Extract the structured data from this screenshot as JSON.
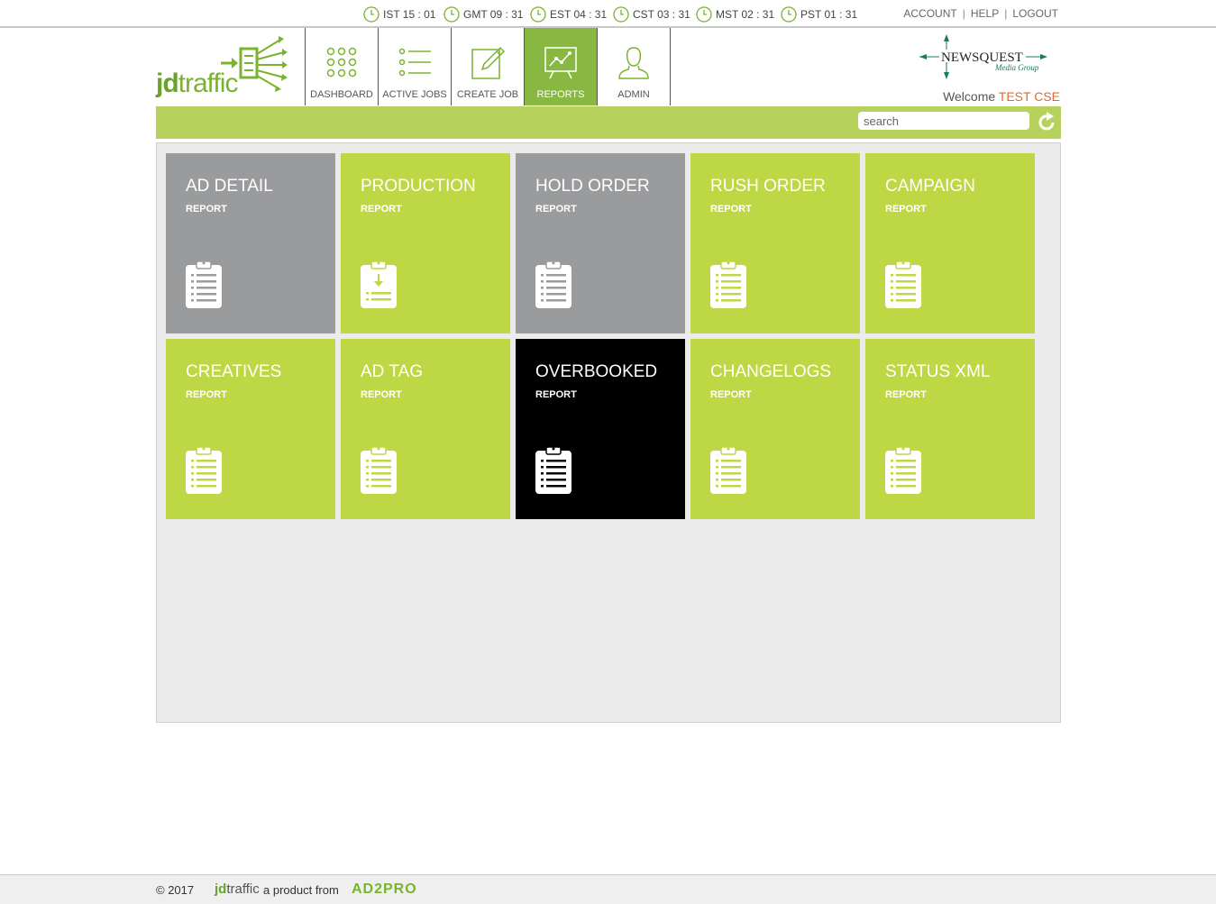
{
  "clocks": [
    {
      "label": "IST 15 : 01"
    },
    {
      "label": "GMT 09 : 31"
    },
    {
      "label": "EST 04 : 31"
    },
    {
      "label": "CST 03 : 31"
    },
    {
      "label": "MST 02 : 31"
    },
    {
      "label": "PST 01 : 31"
    }
  ],
  "toplinks": {
    "account": "ACCOUNT",
    "help": "HELP",
    "logout": "LOGOUT",
    "separator": "|"
  },
  "logo": {
    "jd": "jd",
    "traffic": "traffic"
  },
  "nav": [
    {
      "label": "DASHBOARD",
      "icon": "dots-grid-icon"
    },
    {
      "label": "ACTIVE JOBS",
      "icon": "list-icon"
    },
    {
      "label": "CREATE JOB",
      "icon": "edit-icon"
    },
    {
      "label": "REPORTS",
      "icon": "presentation-chart-icon",
      "active": true
    },
    {
      "label": "ADMIN",
      "icon": "user-icon"
    }
  ],
  "partner_logo": {
    "name": "NEWSQUEST",
    "sub": "Media Group"
  },
  "welcome": {
    "prefix": "Welcome",
    "user": "TEST CSE"
  },
  "search": {
    "placeholder": "search",
    "value": ""
  },
  "tiles": [
    {
      "title": "AD DETAIL",
      "subtitle": "REPORT",
      "color": "#9a9b9d",
      "icon": "clipboard-list-icon"
    },
    {
      "title": "PRODUCTION",
      "subtitle": "REPORT",
      "color": "#bed744",
      "icon": "clipboard-download-icon"
    },
    {
      "title": "HOLD ORDER",
      "subtitle": "REPORT",
      "color": "#9a9b9d",
      "icon": "clipboard-list-icon"
    },
    {
      "title": "RUSH ORDER",
      "subtitle": "REPORT",
      "color": "#bed744",
      "icon": "clipboard-list-icon"
    },
    {
      "title": "CAMPAIGN",
      "subtitle": "REPORT",
      "color": "#bed744",
      "icon": "clipboard-list-icon"
    },
    {
      "title": "CREATIVES",
      "subtitle": "REPORT",
      "color": "#bed744",
      "icon": "clipboard-list-icon"
    },
    {
      "title": "AD TAG",
      "subtitle": "REPORT",
      "color": "#bed744",
      "icon": "clipboard-list-icon"
    },
    {
      "title": "OVERBOOKED",
      "subtitle": "REPORT",
      "color": "#000000",
      "icon": "clipboard-list-icon"
    },
    {
      "title": "CHANGELOGS",
      "subtitle": "REPORT",
      "color": "#bed744",
      "icon": "clipboard-list-icon"
    },
    {
      "title": "STATUS XML",
      "subtitle": "REPORT",
      "color": "#bed744",
      "icon": "clipboard-list-icon"
    }
  ],
  "footer": {
    "copyright": "© 2017",
    "jd": "jd",
    "traffic": "traffic",
    "product_text": "a product from",
    "brand": "AD2PRO"
  },
  "colors": {
    "accent": "#88b842",
    "bar": "#b6d25c",
    "tile_green": "#bed744",
    "tile_gray": "#9a9b9d",
    "user": "#e06a2c"
  }
}
